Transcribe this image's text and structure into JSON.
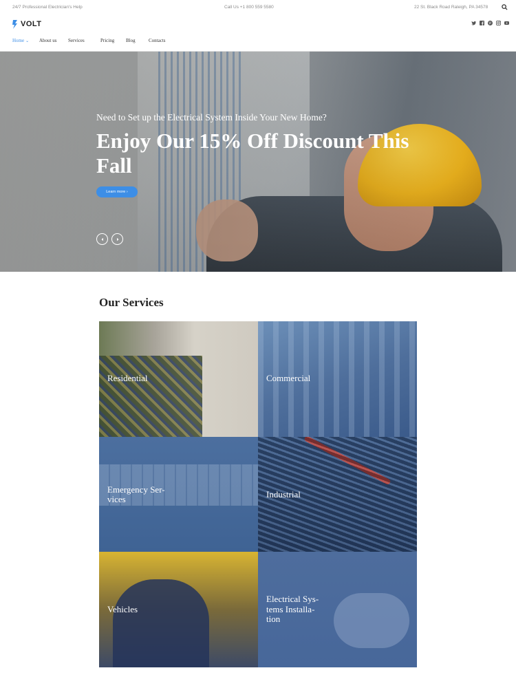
{
  "topbar": {
    "tagline": "24/7 Professional Electrician's Help",
    "phone": "Call Us +1 800 559 5580",
    "address": "22 St. Black Road Raleigh, PA 34578"
  },
  "brand": {
    "logo_text": "VOLT",
    "accent": "#3d8ee6"
  },
  "social": [
    "twitter-icon",
    "facebook-icon",
    "pinterest-icon",
    "instagram-icon",
    "youtube-icon"
  ],
  "nav": {
    "items": [
      {
        "label": "Home",
        "active": true,
        "has_dropdown": true
      },
      {
        "label": "About us"
      },
      {
        "label": "Services"
      },
      {
        "label": "Pricing"
      },
      {
        "label": "Blog"
      },
      {
        "label": "Contacts"
      }
    ]
  },
  "hero": {
    "subtitle": "Need to Set up the Electrical System Inside Your New Home?",
    "title": "Enjoy Our 15% Off Discount This Fall",
    "button_label": "Learn more",
    "button_glyph": "›"
  },
  "services": {
    "heading": "Our Services",
    "items": [
      {
        "label": "Residential"
      },
      {
        "label": "Commercial"
      },
      {
        "label": "Emergency Ser-\nvices"
      },
      {
        "label": "Industrial"
      },
      {
        "label": "Vehicles"
      },
      {
        "label": "Electrical Sys-\ntems Installa-\ntion"
      }
    ]
  }
}
